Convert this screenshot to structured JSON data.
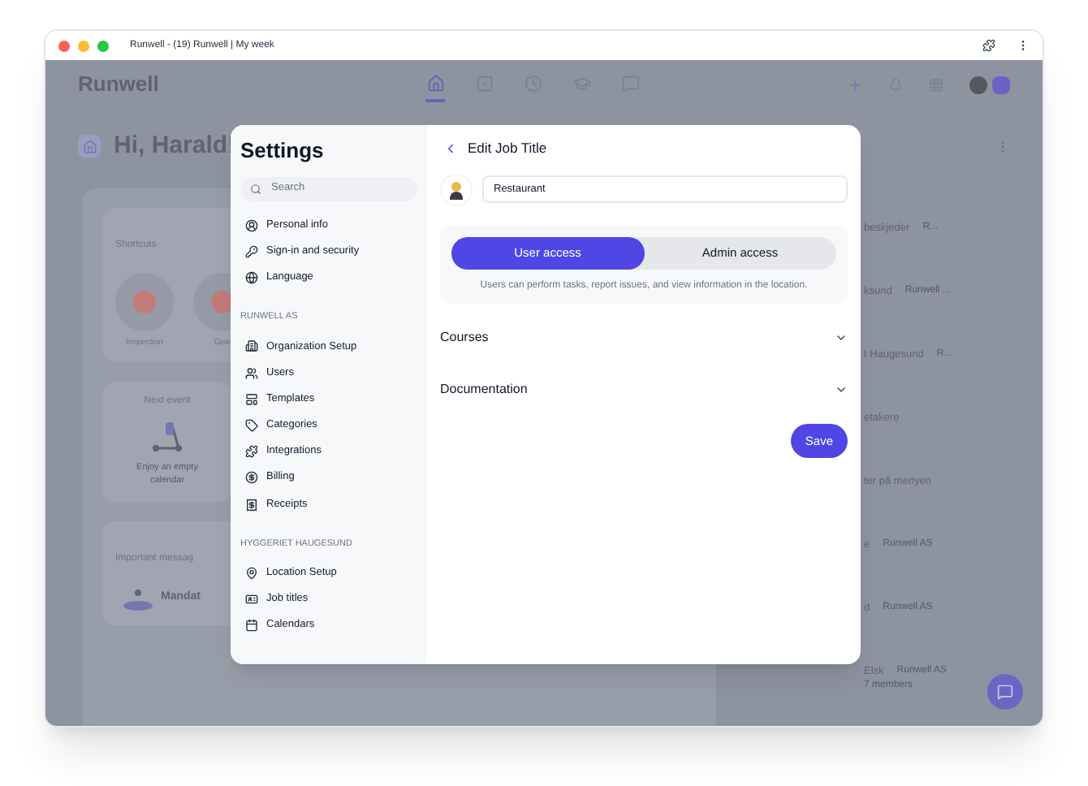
{
  "browser": {
    "title": "Runwell - (19) Runwell | My week"
  },
  "app": {
    "logo": "Runwell",
    "greeting": "Hi, Harald!",
    "nav": [
      {
        "selected": true
      },
      {
        "selected": false
      },
      {
        "selected": false
      },
      {
        "selected": false
      },
      {
        "selected": false
      }
    ],
    "shortcuts": {
      "title": "Shortcuts",
      "items": [
        "Inspection",
        "Give"
      ]
    },
    "next_event": {
      "title": "Next event",
      "empty": "Enjoy an empty calendar"
    },
    "messages": {
      "title": "Important messag",
      "item": "Mandat"
    },
    "list": [
      {
        "title": "beskjeder",
        "meta": "R..."
      },
      {
        "title": "ksund",
        "meta": "Runwell ..."
      },
      {
        "title": "t Haugesund",
        "meta": "R..."
      },
      {
        "title": "etakere"
      },
      {
        "title": "ter på menyen"
      },
      {
        "title": "e",
        "meta": "Runwell AS"
      },
      {
        "title": "d",
        "meta": "Runwell AS"
      },
      {
        "title": "Elsk",
        "meta": "Runwell AS",
        "sub": "7 members"
      }
    ]
  },
  "settings": {
    "title": "Settings",
    "search": {
      "placeholder": "Search"
    },
    "groups": [
      {
        "items": [
          "Personal info",
          "Sign-in and security",
          "Language"
        ]
      },
      {
        "label": "RUNWELL AS",
        "items": [
          "Organization Setup",
          "Users",
          "Templates",
          "Categories",
          "Integrations",
          "Billing",
          "Receipts"
        ]
      },
      {
        "label": "HYGGERIET HAUGESUND",
        "items": [
          "Location Setup",
          "Job titles",
          "Calendars"
        ]
      }
    ]
  },
  "editor": {
    "title": "Edit Job Title",
    "name": {
      "value": "Restaurant"
    },
    "access": [
      {
        "label": "User access",
        "selected": true
      },
      {
        "label": "Admin access",
        "selected": false
      }
    ],
    "description": "Users can perform tasks, report issues, and view information in the location.",
    "sections": [
      {
        "label": "Courses",
        "expanded": false
      },
      {
        "label": "Documentation",
        "expanded": false
      }
    ],
    "save": "Save"
  }
}
